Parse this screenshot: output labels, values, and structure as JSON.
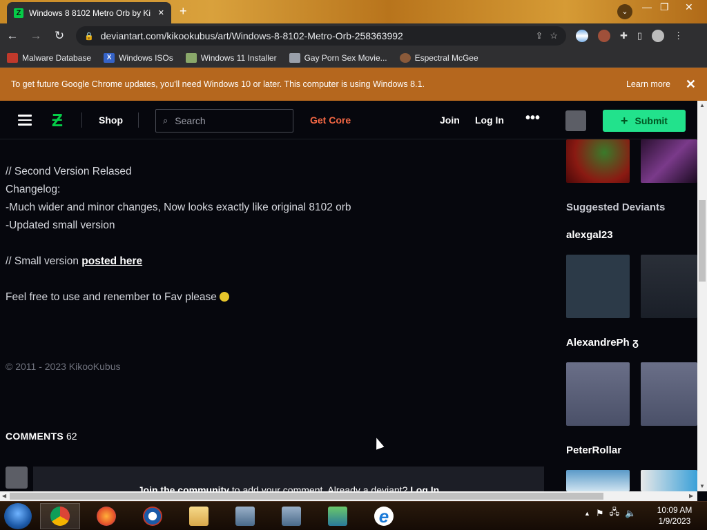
{
  "browser": {
    "tab_title": "Windows 8 8102 Metro Orb by Ki",
    "tab_close": "✕",
    "new_tab": "+",
    "url": "deviantart.com/kikookubus/art/Windows-8-8102-Metro-Orb-258363992",
    "window_controls": [
      "—",
      "❐",
      "✕"
    ],
    "bookmarks": [
      {
        "label": "Malware Database",
        "icon": "ladybug-icon",
        "color": "#c0392b"
      },
      {
        "label": "Windows ISOs",
        "icon": "x-icon",
        "color": "#3563c7"
      },
      {
        "label": "Windows 11 Installer",
        "icon": "image-icon",
        "color": "#8aa86a"
      },
      {
        "label": "Gay Porn Sex Movie...",
        "icon": "site-icon",
        "color": "#9aa0aa"
      },
      {
        "label": "Espectral McGee",
        "icon": "avatar-icon",
        "color": "#8a5a3a"
      }
    ]
  },
  "infobar": {
    "text": "To get future Google Chrome updates, you'll need Windows 10 or later. This computer is using Windows 8.1.",
    "learn_more": "Learn more",
    "close": "✕"
  },
  "site_nav": {
    "shop": "Shop",
    "search_placeholder": "Search",
    "get_core": "Get Core",
    "join": "Join",
    "login": "Log In",
    "more": "•••",
    "submit": "Submit"
  },
  "description": {
    "line1": "// Second Version Relased",
    "line2": "Changelog:",
    "line3": "-Much wider and minor changes, Now looks exactly like original 8102 orb",
    "line4": "-Updated small version",
    "line5_prefix": "// Small version ",
    "line5_link": "posted here",
    "line6": "Feel free to use and renember to Fav please"
  },
  "copyright": "© 2011 - 2023 KikooKubus",
  "comments": {
    "label": "COMMENTS",
    "count": "62",
    "join_link": "Join the community",
    "join_mid": " to add your comment. Already a deviant? ",
    "login_link": "Log In"
  },
  "sidebar": {
    "suggested_title": "Suggested Deviants",
    "deviants": [
      {
        "name": "alexgal23"
      },
      {
        "name": "AlexandrePh",
        "badge": "ᵹ"
      },
      {
        "name": "PeterRollar"
      }
    ]
  },
  "taskbar": {
    "time": "10:09 AM",
    "date": "1/9/2023"
  },
  "colors": {
    "accent_green": "#05cc47",
    "submit_green": "#22e28c",
    "get_core": "#f36744",
    "infobar": "#b5671e"
  }
}
